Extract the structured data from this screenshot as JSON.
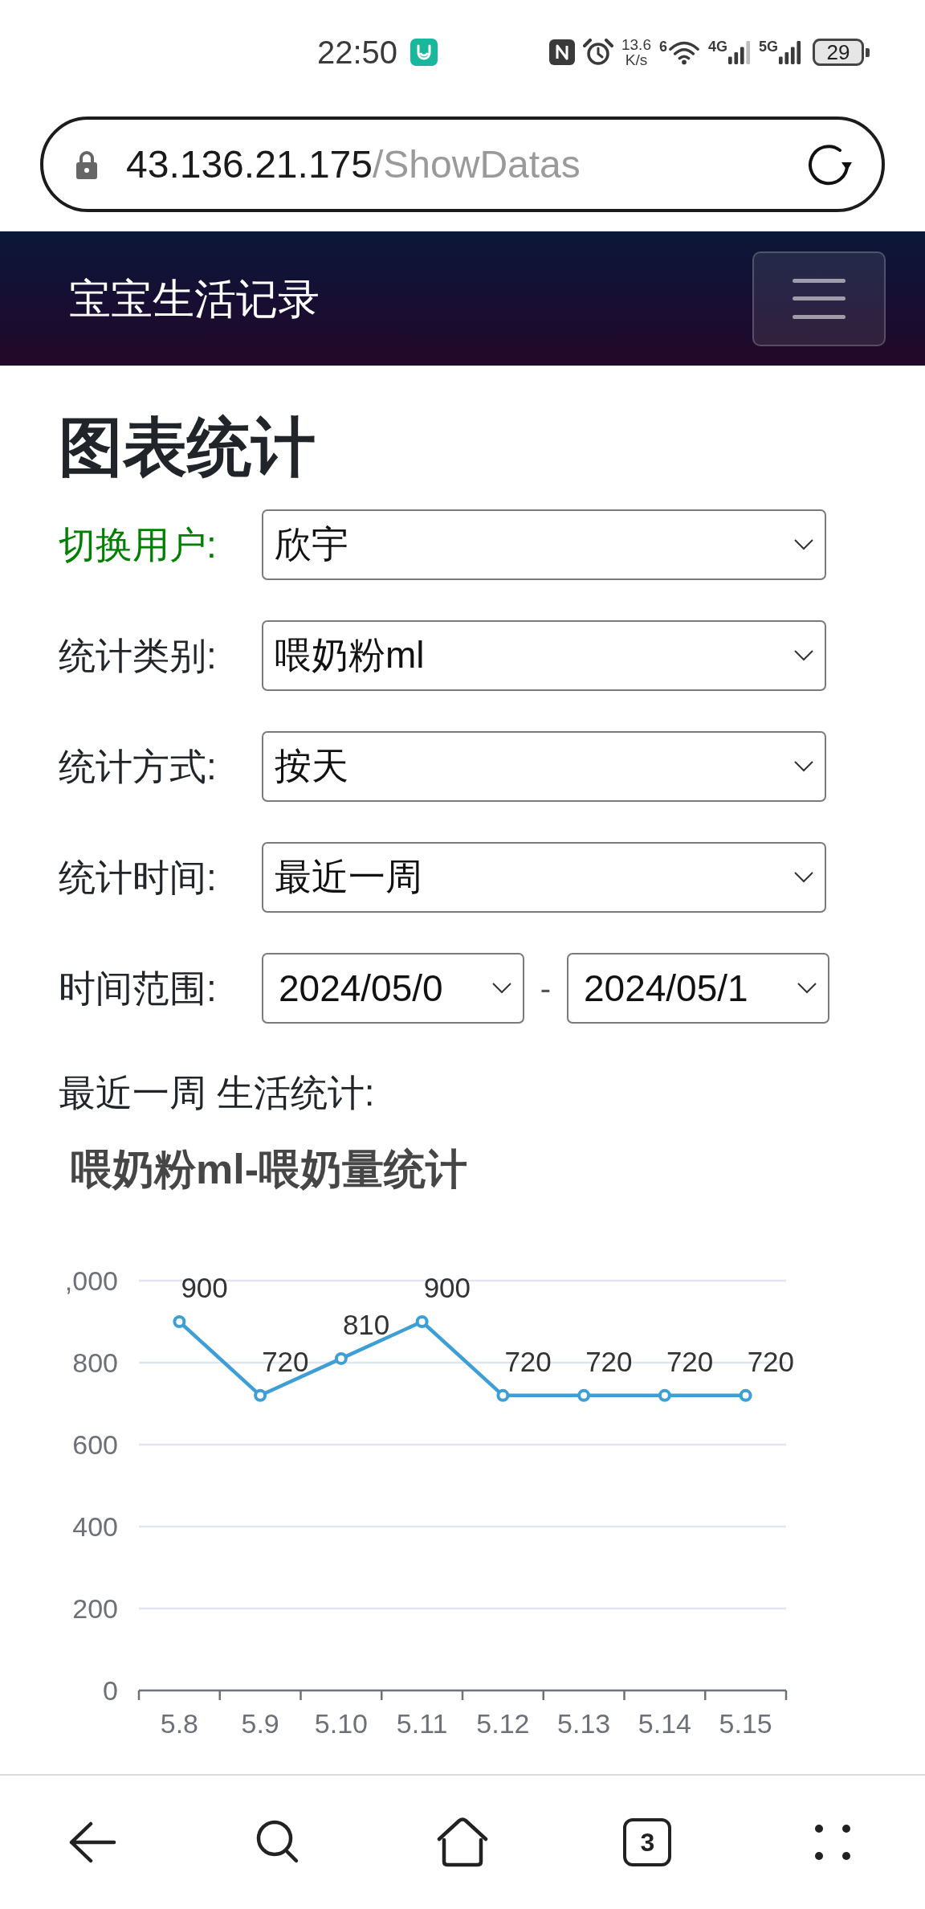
{
  "status_bar": {
    "time": "22:50",
    "speed": "13.6",
    "speed_unit": "K/s",
    "wifi_standard": "6",
    "sim_1_type": "4G",
    "sim_2_type": "5G",
    "battery": "29"
  },
  "address_bar": {
    "host": "43.136.21.175",
    "path": "/ShowDatas"
  },
  "navbar": {
    "brand": "宝宝生活记录"
  },
  "page": {
    "heading": "图表统计",
    "form_rows": [
      {
        "kind": "select",
        "label": "切换用户:",
        "color": "#008000",
        "value": "欣宇"
      },
      {
        "kind": "select",
        "label": "统计类别:",
        "color": "#212529",
        "value": "喂奶粉ml"
      },
      {
        "kind": "select",
        "label": "统计方式:",
        "color": "#212529",
        "value": "按天"
      },
      {
        "kind": "select",
        "label": "统计时间:",
        "color": "#212529",
        "value": "最近一周"
      },
      {
        "kind": "date_range",
        "label": "时间范围:",
        "color": "#212529",
        "start": "2024/05/0",
        "separator": "-",
        "end": "2024/05/1"
      }
    ],
    "summary": "最近一周 生活统计:",
    "chart": {
      "top_axis_label_cut": ",000",
      "chart_data": {
        "type": "line",
        "title": "喂奶粉ml-喂奶量统计",
        "categories": [
          "5.8",
          "5.9",
          "5.10",
          "5.11",
          "5.12",
          "5.13",
          "5.14",
          "5.15"
        ],
        "series": [
          {
            "color": "#3d9fd6",
            "marker": "circle",
            "values": [
              900,
              720,
              810,
              900,
              720,
              720,
              720,
              720
            ]
          }
        ],
        "ylim": [
          0,
          1000
        ],
        "yticks": [
          0,
          200,
          400,
          600,
          800
        ],
        "grid": true,
        "data_labels": true
      }
    }
  },
  "bottom_nav": {
    "tab_count": "3"
  }
}
